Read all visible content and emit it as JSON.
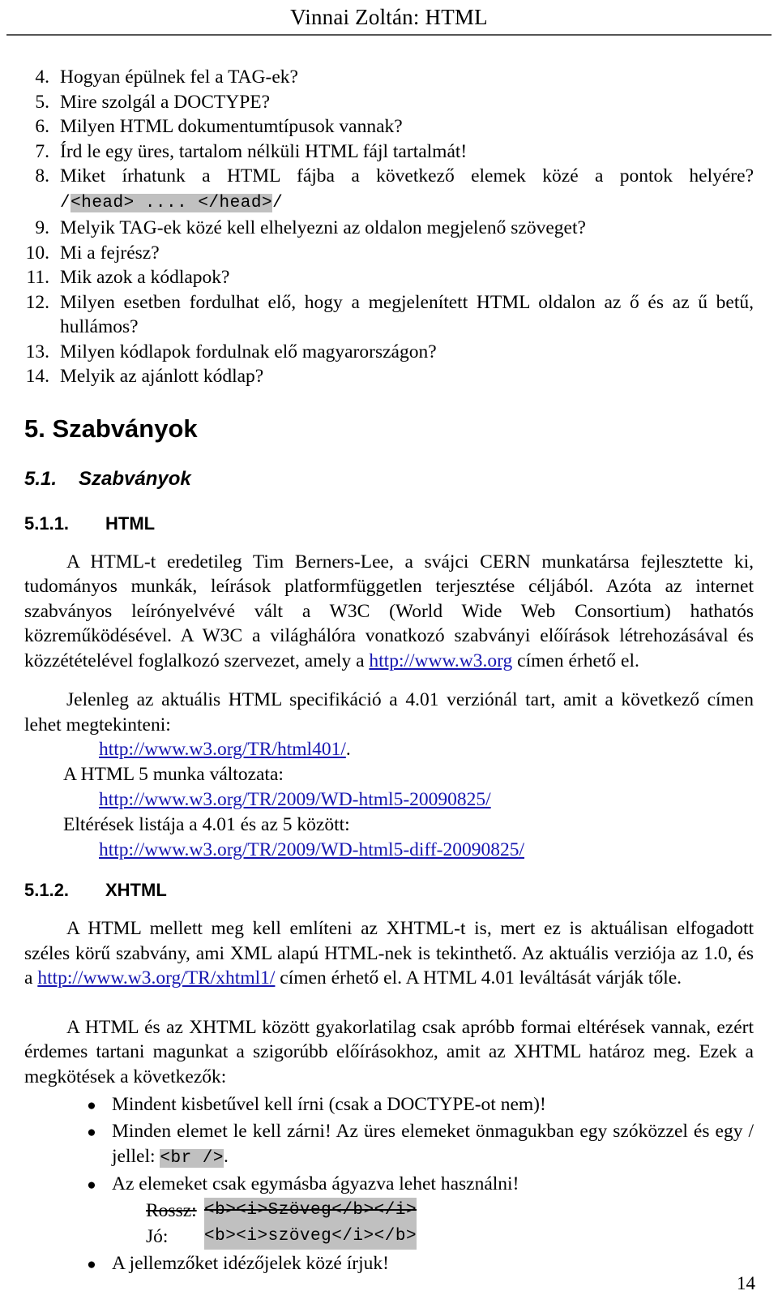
{
  "header": {
    "running_title": "Vinnai Zoltán: HTML"
  },
  "questions": [
    {
      "num": "4.",
      "text": "Hogyan épülnek fel a TAG-ek?"
    },
    {
      "num": "5.",
      "text": "Mire szolgál a DOCTYPE?"
    },
    {
      "num": "6.",
      "text": "Milyen HTML dokumentumtípusok vannak?"
    },
    {
      "num": "7.",
      "text": "Írd le egy üres, tartalom nélküli HTML fájl tartalmát!"
    },
    {
      "num": "8.",
      "text": "Miket írhatunk a HTML fájba a következő elemek közé a pontok helyére?"
    },
    {
      "num": "9.",
      "text": "Melyik TAG-ek közé kell elhelyezni az oldalon megjelenő szöveget?"
    },
    {
      "num": "10.",
      "text": "Mi a fejrész?"
    },
    {
      "num": "11.",
      "text": "Mik azok a kódlapok?"
    },
    {
      "num": "12.",
      "text": "Milyen esetben fordulhat elő, hogy a megjelenített HTML oldalon az ő és az ű betű, hullámos?"
    },
    {
      "num": "13.",
      "text": "Milyen kódlapok fordulnak elő magyarországon?"
    },
    {
      "num": "14.",
      "text": "Melyik az ajánlott kódlap?"
    }
  ],
  "q8_code": {
    "slash_open": "/",
    "code": "<head> .... </head>",
    "slash_close": "/"
  },
  "headings": {
    "chapter": "5. Szabványok",
    "section_num": "5.1.",
    "section_title": "Szabványok",
    "sub1_num": "5.1.1.",
    "sub1_title": "HTML",
    "sub2_num": "5.1.2.",
    "sub2_title": "XHTML"
  },
  "html_section": {
    "para1_before_link": "A HTML-t eredetileg Tim Berners-Lee, a svájci CERN munkatársa fejlesztette ki, tudományos munkák, leírások platformfüggetlen terjesztése céljából. Azóta az internet szabványos leírónyelvévé vált a W3C (World Wide Web Consortium) hathatós közreműködésével. A W3C a világhálóra vonatkozó szabványi előírások létrehozásával és közzétételével foglalkozó szervezet, amely a ",
    "para1_link": "http://www.w3.org",
    "para1_after_link": " címen érhető el.",
    "para2": "Jelenleg az aktuális HTML specifikáció a 4.01 verziónál tart, amit a következő címen lehet megtekinteni:",
    "url1": "http://www.w3.org/TR/html401/",
    "url1_suffix": ".",
    "label_html5": "A HTML 5 munka változata:",
    "url2": "http://www.w3.org/TR/2009/WD-html5-20090825/",
    "label_diff": "Eltérések listája a 4.01 és az 5 között:",
    "url3": "http://www.w3.org/TR/2009/WD-html5-diff-20090825/"
  },
  "xhtml_section": {
    "para1_before_link": "A HTML mellett meg kell említeni az XHTML-t is, mert ez is aktuálisan elfogadott széles körű szabvány, ami XML alapú HTML-nek is tekinthető. Az aktuális verziója az 1.0, és a ",
    "para1_link": "http://www.w3.org/TR/xhtml1/",
    "para1_after_link": " címen érhető el. A HTML 4.01 leváltását várják tőle.",
    "para2": "A HTML és az XHTML között gyakorlatilag csak apróbb formai eltérések vannak, ezért érdemes tartani magunkat a szigorúbb előírásokhoz, amit az XHTML határoz meg. Ezek a megkötések a következők:"
  },
  "rules": [
    {
      "text": "Mindent kisbetűvel kell írni (csak a DOCTYPE-ot nem)!"
    },
    {
      "text_before_code": "Minden elemet le kell zárni! Az üres elemeket önmagukban egy szóközzel és egy / jellel: ",
      "code": "<br />",
      "text_after_code": "."
    },
    {
      "text": "Az elemeket csak egymásba ágyazva lehet használni!"
    },
    {
      "text": "A jellemzőket idézőjelek közé írjuk!"
    }
  ],
  "code_examples": {
    "bad_label": "Rossz:",
    "bad_code": "<b><i>Szöveg</b></i>",
    "good_label": "Jó:",
    "good_code": "<b><i>szöveg</i></b>"
  },
  "footer": {
    "page_number": "14"
  },
  "colors": {
    "link": "#1616b0",
    "code_highlight": "#c0c0c0",
    "rule": "#555555"
  }
}
